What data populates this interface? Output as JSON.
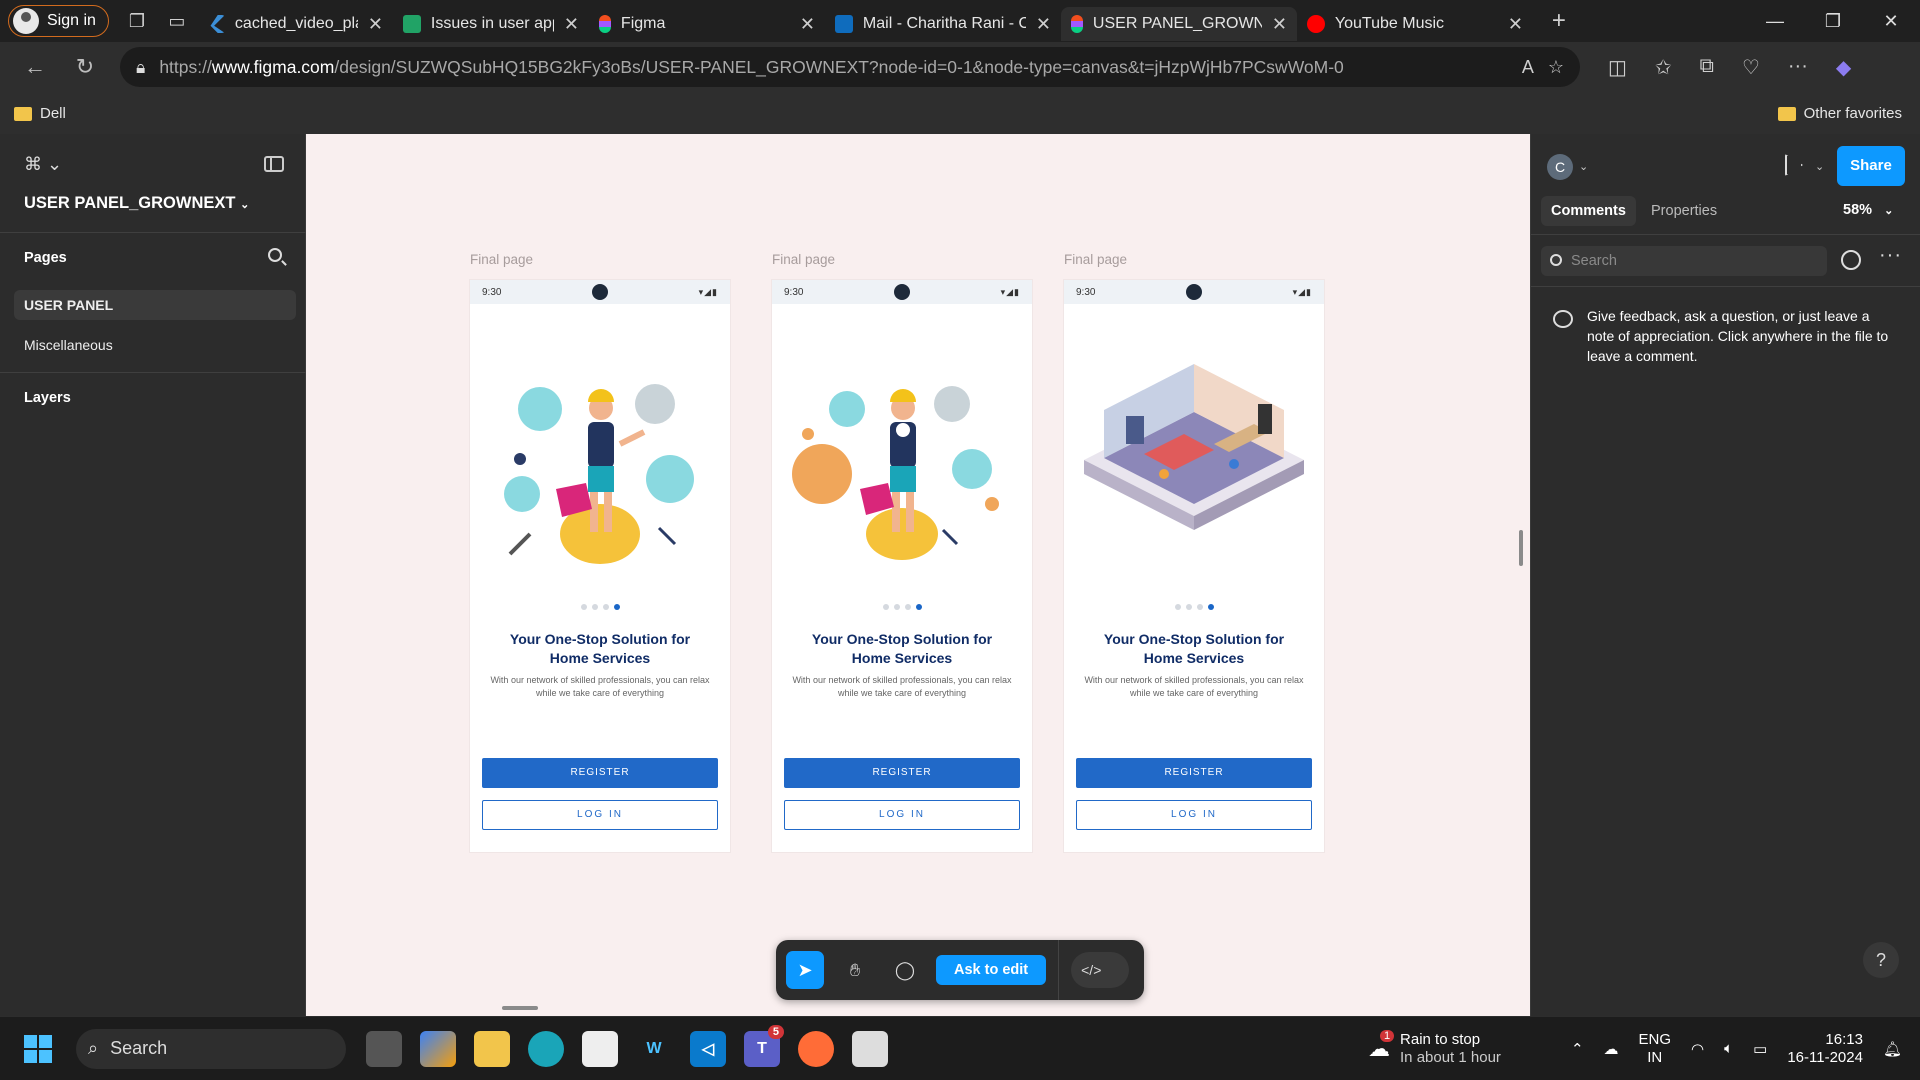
{
  "browser": {
    "signin_label": "Sign in",
    "tabs": [
      {
        "title": "cached_video_player_plu",
        "color": "#3b8ed6"
      },
      {
        "title": "Issues in user app - Goo",
        "color": "#21a366"
      },
      {
        "title": "Figma",
        "color": "#f24e1e"
      },
      {
        "title": "Mail - Charitha Rani - Ou",
        "color": "#0f6cbd"
      },
      {
        "title": "USER PANEL_GROWNEX",
        "color": "#f24e1e"
      },
      {
        "title": "YouTube Music",
        "color": "#ff0000"
      }
    ],
    "url_prefix": "https://",
    "url_host": "www.figma.com",
    "url_path": "/design/SUZWQSubHQ15BG2kFy3oBs/USER-PANEL_GROWNEXT?node-id=0-1&node-type=canvas&t=jHzpWjHb7PCswWoM-0",
    "favorites": {
      "left": "Dell",
      "right": "Other favorites"
    }
  },
  "figma": {
    "file_title": "USER PANEL_GROWNEXT",
    "pages_heading": "Pages",
    "pages": [
      "USER PANEL",
      "Miscellaneous"
    ],
    "layers_heading": "Layers",
    "frames": [
      {
        "label": "Final page",
        "time": "9:30",
        "title": "Your One-Stop Solution for Home Services",
        "subtitle": "With our network of skilled professionals, you can relax while we take care of everything",
        "register": "REGISTER",
        "login": "LOG IN",
        "active_dot": 4
      },
      {
        "label": "Final page",
        "time": "9:30",
        "title": "Your One-Stop Solution for Home Services",
        "subtitle": "With our network of skilled professionals, you can relax while we take care of everything",
        "register": "REGISTER",
        "login": "LOG IN",
        "active_dot": 4
      },
      {
        "label": "Final page",
        "time": "9:30",
        "title": "Your One-Stop Solution for Home Services",
        "subtitle": "With our network of skilled professionals, you can relax while we take care of everything",
        "register": "REGISTER",
        "login": "LOG IN",
        "active_dot": 4
      }
    ],
    "toolbar": {
      "ask_to_edit": "Ask to edit",
      "dev_icon": "</>"
    },
    "right": {
      "avatar_initial": "C",
      "share_label": "Share",
      "tabs": [
        "Comments",
        "Properties"
      ],
      "zoom": "58%",
      "search_placeholder": "Search",
      "hint": "Give feedback, ask a question, or just leave a note of appreciation. Click anywhere in the file to leave a comment.",
      "help": "?"
    }
  },
  "taskbar": {
    "search_label": "Search",
    "teams_badge": "5",
    "weather_badge": "1",
    "weather_title": "Rain to stop",
    "weather_sub": "In about 1 hour",
    "lang_1": "ENG",
    "lang_2": "IN",
    "time": "16:13",
    "date": "16-11-2024"
  }
}
